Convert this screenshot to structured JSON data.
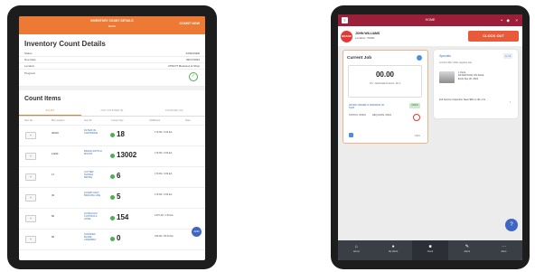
{
  "left": {
    "header": {
      "title": "INVENTORY COUNT DETAILS",
      "subtitle": "BACK",
      "action": "COUNT NOW"
    },
    "page_title": "Inventory Count Details",
    "fields": [
      {
        "key": "Status",
        "value": "ASSIGNED"
      },
      {
        "key": "Due Date",
        "value": "09/17/2024"
      },
      {
        "key": "Location",
        "value": "3750 PT Business & Shop"
      }
    ],
    "progress_label": "Progress",
    "section_title": "Count Items",
    "tabs": [
      "IN LIST",
      "NOT COUNTED (6)",
      "COUNTED (12)"
    ],
    "columns": [
      "Item No.",
      "Bin Location",
      "Item ID",
      "Current Qty",
      "UOM/Cost",
      "Note"
    ],
    "rows": [
      {
        "button": "+",
        "bin": "30100",
        "desc": "FILTER OIL CARTRIDGE",
        "qty": "18",
        "meta": "179.99 / 3.99 EA"
      },
      {
        "button": "+",
        "bin": "11100",
        "desc": "BRAKE SWITCH MOUNT",
        "qty": "13002",
        "meta": "179.99 / 3.99 EA"
      },
      {
        "button": "+",
        "bin": "17",
        "desc": "CUTTER NOZZLE BRUSH",
        "qty": "6",
        "meta": "179.99 / 3.99 EA"
      },
      {
        "button": "+",
        "bin": "32",
        "desc": "GUARD ASSY BRAKING LINE",
        "qty": "5",
        "meta": "179.99 / 3.99 EA"
      },
      {
        "button": "+",
        "bin": "50",
        "desc": "HYDRAULIC CONTROLS HOSE",
        "qty": "154",
        "meta": "1375.39 / 1.50 EA"
      },
      {
        "button": "+",
        "bin": "60",
        "desc": "SCRAPER BLADE ASSEMBLY",
        "qty": "0",
        "meta": "189.99 / 35.00 EA"
      }
    ],
    "fab_label": "ADD"
  },
  "right": {
    "header": {
      "title": "HOME",
      "menu_icon": "menu-icon"
    },
    "employee": {
      "logo": "BRAND",
      "name": "JOHN WILLIAMS",
      "location": "Location: 70000"
    },
    "clock_out": "CLOCK OUT",
    "card1": {
      "title": "Current Job",
      "hours": "00.00",
      "hours_label": "hrs - Estimated Hours: 10.1",
      "job_link": "WORK ORDER # 26000040 JD 6120",
      "badge": "OPEN",
      "job_status": "STATUS: OPEN",
      "job_date": "REQ DATE: 09/24",
      "footer": "VIEW"
    },
    "card2": {
      "title": "Specials",
      "badge": "1 / 4",
      "subtitle": "Limited offer while supplies last",
      "item_link": "1 DEAL",
      "item_name": "FILTER PACK ON SALE",
      "item_note": "Ends Sep 30, 2024",
      "bottom_text": "Full Service Inspection Save $50 on 4K+ hrs",
      "chevron": "›"
    },
    "nav": [
      "Home",
      "My Work",
      "Clock",
      "Alerts",
      "More"
    ]
  },
  "colors": {
    "orange": "#ec7a35",
    "maroon": "#9c1f3a",
    "green": "#4caf50",
    "blue": "#3f67c2"
  }
}
